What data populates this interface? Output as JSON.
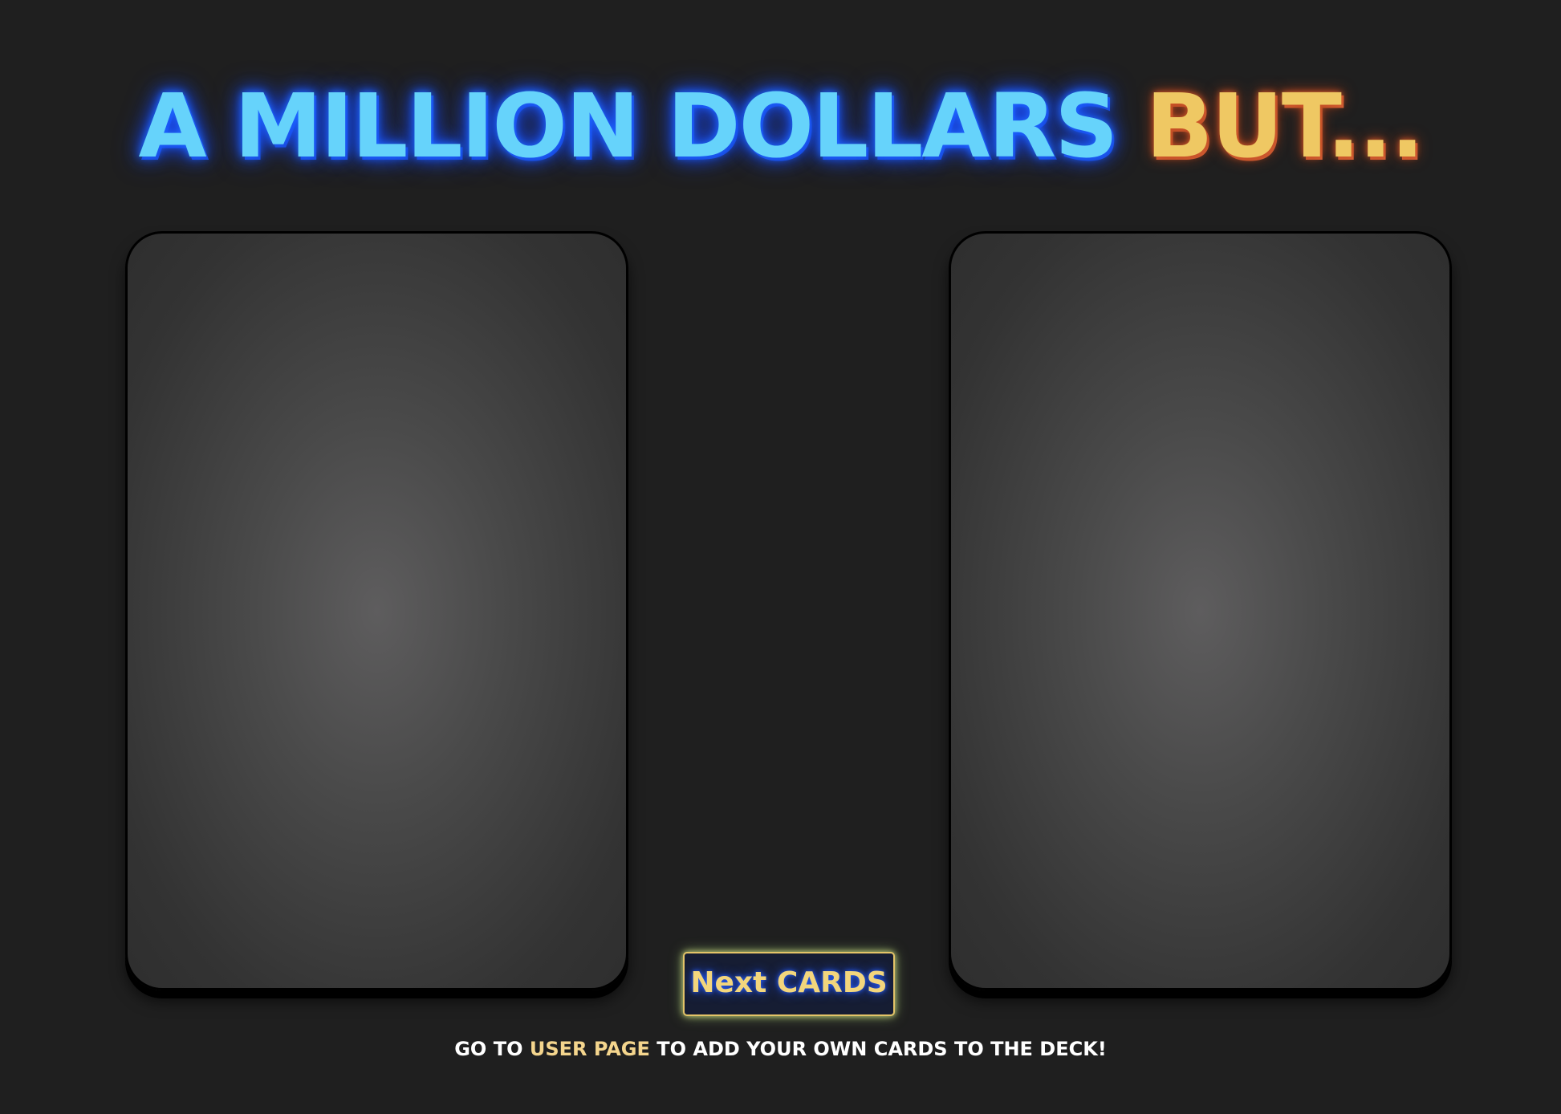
{
  "header": {
    "title_main": "A MILLION DOLLARS",
    "title_accent": "BUT..."
  },
  "cards": {
    "left_label": "",
    "right_label": ""
  },
  "actions": {
    "next_label": "Next CARDS"
  },
  "footer": {
    "prefix": "GO TO",
    "link": "USER PAGE",
    "suffix": "TO ADD YOUR OWN CARDS TO THE DECK!"
  },
  "colors": {
    "background": "#1f1f1f",
    "title_blue": "#66d3fb",
    "title_gold": "#efc863",
    "button_bg": "#161d33",
    "button_border": "#e4c468",
    "link": "#f4d58d"
  }
}
